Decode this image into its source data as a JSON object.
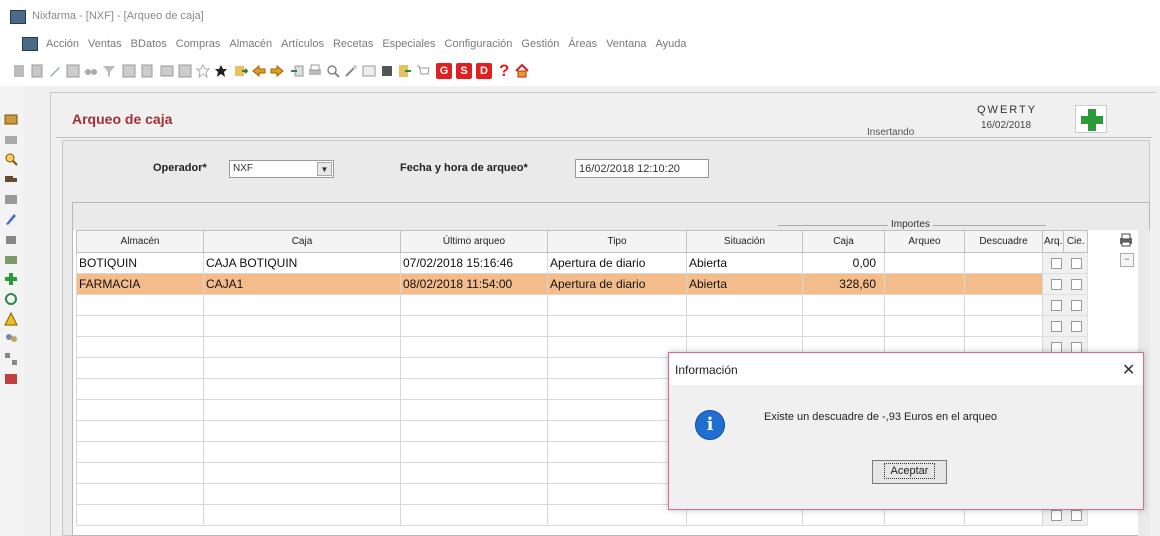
{
  "window": {
    "title": "Nixfarma - [NXF] - [Arqueo de caja]"
  },
  "menu": [
    "Acción",
    "Ventas",
    "BDatos",
    "Compras",
    "Almacén",
    "Artículos",
    "Recetas",
    "Especiales",
    "Configuración",
    "Gestión",
    "Áreas",
    "Ventana",
    "Ayuda"
  ],
  "toolbar": {
    "red_g": "G",
    "red_s": "S",
    "red_d": "D",
    "help": "?"
  },
  "header": {
    "title": "Arqueo de caja",
    "status": "Insertando",
    "brand": "QWERTY",
    "date": "16/02/2018"
  },
  "form": {
    "operador_label": "Operador*",
    "operador_value": "NXF",
    "fecha_label": "Fecha y hora de arqueo*",
    "fecha_value": "16/02/2018 12:10:20"
  },
  "table": {
    "group_label": "Importes",
    "columns": [
      "Almacén",
      "Caja",
      "Último arqueo",
      "Tipo",
      "Situación",
      "Caja",
      "Arqueo",
      "Descuadre",
      "Arq.",
      "Cie."
    ],
    "rows": [
      {
        "almacen": "BOTIQUIN",
        "caja": "CAJA BOTIQUIN",
        "ultimo": "07/02/2018 15:16:46",
        "tipo": "Apertura de diario",
        "situacion": "Abierta",
        "importe_caja": "0,00",
        "arqueo": "",
        "descuadre": ""
      },
      {
        "almacen": "FARMACIA",
        "caja": "CAJA1",
        "ultimo": "08/02/2018 11:54:00",
        "tipo": "Apertura de diario",
        "situacion": "Abierta",
        "importe_caja": "328,60",
        "arqueo": "",
        "descuadre": ""
      }
    ],
    "selected_row_color": "#f4bc8a"
  },
  "dialog": {
    "title": "Información",
    "close": "✕",
    "message": "Existe un descuadre de -,93 Euros en el arqueo",
    "button": "Aceptar",
    "border_color": "#d86a9a"
  }
}
